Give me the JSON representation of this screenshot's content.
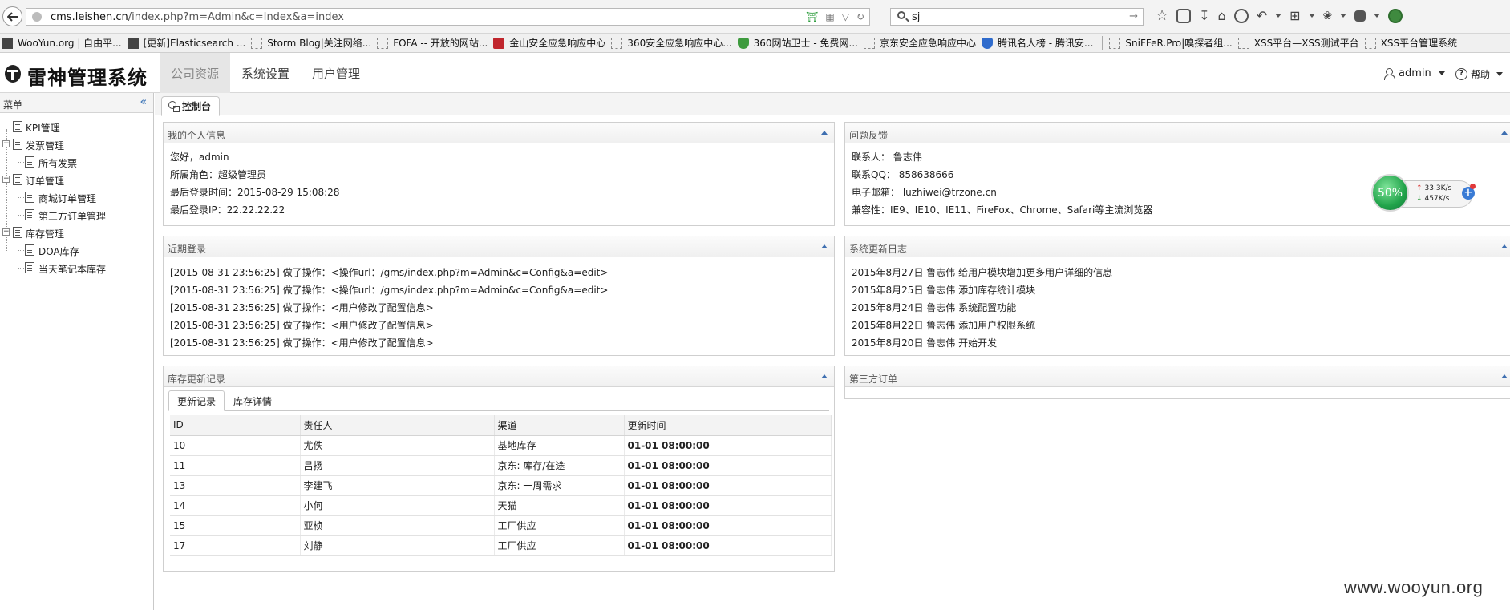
{
  "browser": {
    "url_host": "cms.leishen.cn",
    "url_path": "/index.php?m=Admin&c=Index&a=index",
    "search_query": "sj"
  },
  "bookmarks": [
    {
      "label": "WooYun.org | 自由平...",
      "icon": "solid"
    },
    {
      "label": "[更新]Elasticsearch ...",
      "icon": "solid"
    },
    {
      "label": "Storm Blog|关注网络...",
      "icon": "page"
    },
    {
      "label": "FOFA -- 开放的网站...",
      "icon": "page"
    },
    {
      "label": "金山安全应急响应中心",
      "icon": "red"
    },
    {
      "label": "360安全应急响应中心...",
      "icon": "page"
    },
    {
      "label": "360网站卫士 - 免费网...",
      "icon": "shield-g"
    },
    {
      "label": "京东安全应急响应中心",
      "icon": "page"
    },
    {
      "label": "腾讯名人榜 - 腾讯安...",
      "icon": "shield-b"
    },
    {
      "label": "SniFFeR.Pro|嗅探者组...",
      "icon": "page"
    },
    {
      "label": "XSS平台—XSS测试平台",
      "icon": "page"
    },
    {
      "label": "XSS平台管理系统",
      "icon": "page"
    }
  ],
  "app": {
    "title": "雷神管理系统",
    "nav": [
      "公司资源",
      "系统设置",
      "用户管理"
    ],
    "user": "admin",
    "help": "帮助"
  },
  "sidebar": {
    "title": "菜单",
    "collapse_glyph": "«",
    "items": [
      {
        "label": "KPI管理"
      },
      {
        "label": "发票管理"
      },
      {
        "label": "所有发票"
      },
      {
        "label": "订单管理"
      },
      {
        "label": "商城订单管理"
      },
      {
        "label": "第三方订单管理"
      },
      {
        "label": "库存管理"
      },
      {
        "label": "DOA库存"
      },
      {
        "label": "当天笔记本库存"
      }
    ]
  },
  "main": {
    "tab": "控制台",
    "personal": {
      "title": "我的个人信息",
      "lines": [
        "您好，admin",
        "所属角色：超级管理员",
        "最后登录时间：2015-08-29 15:08:28",
        "最后登录IP：22.22.22.22"
      ]
    },
    "feedback": {
      "title": "问题反馈",
      "lines": [
        "联系人：  鲁志伟",
        "联系QQ：  858638666",
        "电子邮箱：  luzhiwei@trzone.cn",
        "兼容性：IE9、IE10、IE11、FireFox、Chrome、Safari等主流浏览器"
      ]
    },
    "recent": {
      "title": "近期登录",
      "lines": [
        "[2015-08-31 23:56:25] 做了操作：<操作url：/gms/index.php?m=Admin&c=Config&a=edit>",
        "[2015-08-31 23:56:25] 做了操作：<操作url：/gms/index.php?m=Admin&c=Config&a=edit>",
        "[2015-08-31 23:56:25] 做了操作：<用户修改了配置信息>",
        "[2015-08-31 23:56:25] 做了操作：<用户修改了配置信息>",
        "[2015-08-31 23:56:25] 做了操作：<用户修改了配置信息>"
      ]
    },
    "changelog": {
      "title": "系统更新日志",
      "lines": [
        "2015年8月27日 鲁志伟 给用户模块增加更多用户详细的信息",
        "2015年8月25日 鲁志伟 添加库存统计模块",
        "2015年8月24日 鲁志伟 系统配置功能",
        "2015年8月22日 鲁志伟 添加用户权限系统",
        "2015年8月20日 鲁志伟 开始开发"
      ]
    },
    "inventory": {
      "title": "库存更新记录",
      "tabs": [
        "更新记录",
        "库存详情"
      ],
      "columns": [
        "ID",
        "责任人",
        "渠道",
        "更新时间"
      ],
      "rows": [
        [
          "10",
          "尤佚",
          "基地库存",
          "01-01 08:00:00"
        ],
        [
          "11",
          "吕扬",
          "京东: 库存/在途",
          "01-01 08:00:00"
        ],
        [
          "13",
          "李建飞",
          "京东: 一周需求",
          "01-01 08:00:00"
        ],
        [
          "14",
          "小何",
          "天猫",
          "01-01 08:00:00"
        ],
        [
          "15",
          "亚桢",
          "工厂供应",
          "01-01 08:00:00"
        ],
        [
          "17",
          "刘静",
          "工厂供应",
          "01-01 08:00:00"
        ]
      ]
    },
    "third_party": {
      "title": "第三方订单"
    }
  },
  "speed_widget": {
    "percent": "50%",
    "upload": "33.3K/s",
    "download": "457K/s"
  },
  "watermark": "www.wooyun.org"
}
